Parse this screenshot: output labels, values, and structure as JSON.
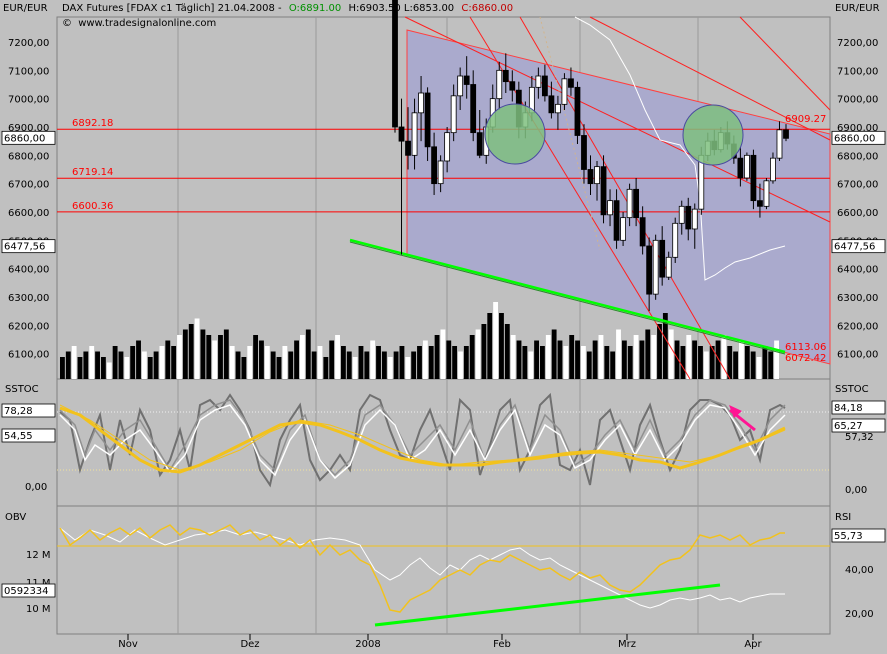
{
  "header": {
    "unit_left": "EUR/EUR",
    "unit_right": "EUR/EUR",
    "title": "DAX Futures [FDAX c1  Täglich] 21.04.2008 -",
    "open": "O:6891.00",
    "high_low": "H:6903.50 L:6853.00",
    "close": "C:6860.00",
    "website": "www.tradesignalonline.com"
  },
  "colors": {
    "panel_bg": "#c0c0c0",
    "channel_fill": "#aaaacd",
    "level_line": "#ff0000",
    "support_line": "#00ff00",
    "stoch_slow": "#f2c21d",
    "obv_line": "#f2c21d",
    "highlight_circle": "#7fbf7f"
  },
  "chart_data": [
    {
      "type": "candlestick",
      "panel": "price",
      "ylim": [
        6000,
        7300
      ],
      "yticks": [
        "7200,00",
        "7100,00",
        "7000,00",
        "6900,00",
        "6800,00",
        "6700,00",
        "6600,00",
        "6500,00",
        "6400,00",
        "6300,00",
        "6200,00",
        "6100,00"
      ],
      "last_price_label": "6860,00",
      "marker_label": "6477,56",
      "levels": [
        {
          "value": 6892.18,
          "label": "6892.18"
        },
        {
          "value": 6719.14,
          "label": "6719.14"
        },
        {
          "value": 6600.36,
          "label": "6600.36"
        }
      ],
      "line_labels": [
        "6909.27",
        "6113.06",
        "6072.42"
      ],
      "candles": [
        [
          7480,
          7540,
          6880,
          6900
        ],
        [
          6900,
          7000,
          6450,
          6850
        ],
        [
          6850,
          6970,
          6750,
          6800
        ],
        [
          6800,
          7000,
          6750,
          6950
        ],
        [
          6950,
          7080,
          6850,
          7020
        ],
        [
          7020,
          7040,
          6780,
          6830
        ],
        [
          6830,
          6880,
          6660,
          6700
        ],
        [
          6700,
          6800,
          6670,
          6780
        ],
        [
          6780,
          6900,
          6740,
          6880
        ],
        [
          6880,
          7050,
          6850,
          7010
        ],
        [
          7010,
          7110,
          6960,
          7080
        ],
        [
          7080,
          7150,
          7000,
          7050
        ],
        [
          7050,
          7100,
          6850,
          6880
        ],
        [
          6880,
          6960,
          6790,
          6800
        ],
        [
          6800,
          6930,
          6770,
          6900
        ],
        [
          6900,
          7050,
          6880,
          7000
        ],
        [
          7000,
          7130,
          6960,
          7100
        ],
        [
          7100,
          7160,
          7020,
          7060
        ],
        [
          7060,
          7100,
          6990,
          7030
        ],
        [
          7030,
          7060,
          6860,
          6900
        ],
        [
          6900,
          6990,
          6860,
          6950
        ],
        [
          6950,
          7080,
          6920,
          7040
        ],
        [
          7040,
          7110,
          7000,
          7080
        ],
        [
          7080,
          7120,
          6990,
          7010
        ],
        [
          7010,
          7060,
          6930,
          6950
        ],
        [
          6950,
          7010,
          6890,
          6980
        ],
        [
          6980,
          7090,
          6960,
          7070
        ],
        [
          7070,
          7110,
          7010,
          7040
        ],
        [
          7040,
          7060,
          6840,
          6870
        ],
        [
          6870,
          6910,
          6700,
          6750
        ],
        [
          6750,
          6800,
          6660,
          6700
        ],
        [
          6700,
          6780,
          6640,
          6760
        ],
        [
          6760,
          6800,
          6560,
          6590
        ],
        [
          6590,
          6680,
          6550,
          6640
        ],
        [
          6640,
          6680,
          6470,
          6500
        ],
        [
          6500,
          6600,
          6480,
          6580
        ],
        [
          6580,
          6700,
          6550,
          6680
        ],
        [
          6680,
          6720,
          6550,
          6580
        ],
        [
          6580,
          6620,
          6450,
          6480
        ],
        [
          6480,
          6510,
          6250,
          6310
        ],
        [
          6310,
          6520,
          6290,
          6500
        ],
        [
          6500,
          6550,
          6340,
          6370
        ],
        [
          6370,
          6460,
          6360,
          6440
        ],
        [
          6440,
          6580,
          6420,
          6560
        ],
        [
          6560,
          6640,
          6520,
          6620
        ],
        [
          6620,
          6650,
          6500,
          6540
        ],
        [
          6540,
          6630,
          6470,
          6610
        ],
        [
          6610,
          6830,
          6590,
          6800
        ],
        [
          6800,
          6880,
          6780,
          6850
        ],
        [
          6850,
          6890,
          6800,
          6820
        ],
        [
          6820,
          6900,
          6810,
          6880
        ],
        [
          6880,
          6920,
          6820,
          6840
        ],
        [
          6840,
          6870,
          6770,
          6790
        ],
        [
          6790,
          6830,
          6690,
          6720
        ],
        [
          6720,
          6810,
          6710,
          6800
        ],
        [
          6800,
          6820,
          6610,
          6640
        ],
        [
          6640,
          6700,
          6580,
          6620
        ],
        [
          6620,
          6720,
          6610,
          6710
        ],
        [
          6710,
          6810,
          6700,
          6790
        ],
        [
          6790,
          6920,
          6780,
          6890
        ],
        [
          6890,
          6910,
          6850,
          6860
        ]
      ]
    },
    {
      "type": "bar",
      "panel": "volume",
      "note": "unlabeled volume bars",
      "values": [
        4,
        5,
        6,
        4,
        5,
        6,
        5,
        4,
        3,
        6,
        5,
        4,
        6,
        7,
        5,
        4,
        5,
        6,
        7,
        6,
        8,
        9,
        10,
        11,
        9,
        8,
        7,
        8,
        9,
        6,
        5,
        4,
        6,
        8,
        7,
        6,
        5,
        4,
        6,
        5,
        7,
        8,
        9,
        5,
        6,
        4,
        7,
        8,
        6,
        5,
        4,
        6,
        5,
        7,
        6,
        5,
        4,
        5,
        6,
        4,
        5,
        6,
        7,
        6,
        8,
        9,
        7,
        6,
        5,
        6,
        8,
        9,
        10,
        12,
        14,
        12,
        10,
        8,
        7,
        6,
        5,
        7,
        6,
        8,
        9,
        7,
        6,
        8,
        7,
        6,
        5,
        7,
        8,
        6,
        5,
        9,
        7,
        6,
        8,
        7,
        9,
        8,
        10,
        12,
        9,
        7,
        6,
        8,
        7,
        6,
        5,
        6,
        7,
        8,
        6,
        5,
        7,
        6,
        5,
        4,
        6,
        5,
        7
      ]
    },
    {
      "type": "line",
      "panel": "ssstoc",
      "label": "SSTOC",
      "ylim": [
        -5,
        95
      ],
      "left_labels": [
        "78,28",
        "54,55",
        "0,00"
      ],
      "right_labels": [
        "84,18",
        "65,27",
        "57,32",
        "0,00"
      ]
    },
    {
      "type": "line",
      "panel": "obv_rsi",
      "left_label": "OBV",
      "right_label": "RSI",
      "left_ticks": [
        "12 M",
        "11 M",
        "10 M"
      ],
      "left_marker": "0592334",
      "right_ticks": [
        "40,00",
        "20,00"
      ],
      "right_marker": "55,73"
    }
  ],
  "x_axis": {
    "labels": [
      "Nov",
      "Dez",
      "2008",
      "Feb",
      "Mrz",
      "Apr"
    ]
  }
}
